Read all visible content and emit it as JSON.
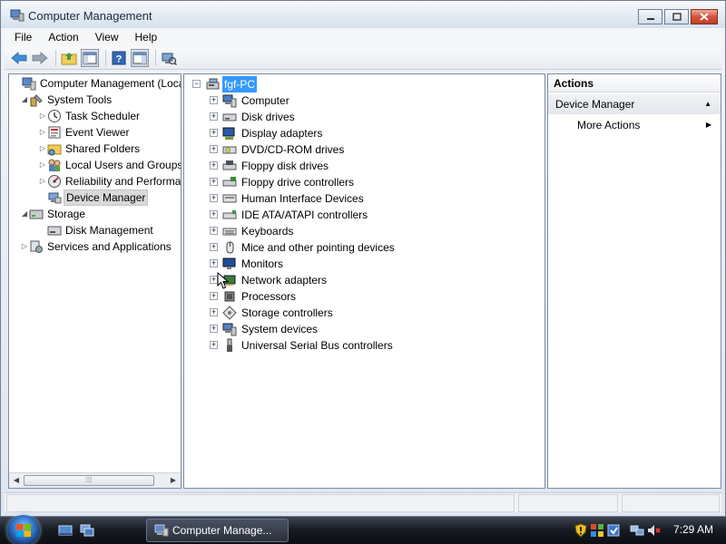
{
  "window": {
    "title": "Computer Management"
  },
  "menu": [
    "File",
    "Action",
    "View",
    "Help"
  ],
  "left_tree": [
    {
      "label": "Computer Management (Local",
      "level": 0,
      "expander": "",
      "icon": "computer-management-icon",
      "selected": false
    },
    {
      "label": "System Tools",
      "level": 1,
      "expander": "expanded",
      "icon": "system-tools-icon",
      "selected": false
    },
    {
      "label": "Task Scheduler",
      "level": 2,
      "expander": "collapsed",
      "icon": "clock-icon",
      "selected": false
    },
    {
      "label": "Event Viewer",
      "level": 2,
      "expander": "collapsed",
      "icon": "event-viewer-icon",
      "selected": false
    },
    {
      "label": "Shared Folders",
      "level": 2,
      "expander": "collapsed",
      "icon": "shared-folder-icon",
      "selected": false
    },
    {
      "label": "Local Users and Groups",
      "level": 2,
      "expander": "collapsed",
      "icon": "users-icon",
      "selected": false
    },
    {
      "label": "Reliability and Performa",
      "level": 2,
      "expander": "collapsed",
      "icon": "performance-icon",
      "selected": false
    },
    {
      "label": "Device Manager",
      "level": 2,
      "expander": "",
      "icon": "device-manager-icon",
      "selected": true
    },
    {
      "label": "Storage",
      "level": 1,
      "expander": "expanded",
      "icon": "storage-icon",
      "selected": false
    },
    {
      "label": "Disk Management",
      "level": 2,
      "expander": "",
      "icon": "disk-management-icon",
      "selected": false
    },
    {
      "label": "Services and Applications",
      "level": 1,
      "expander": "collapsed",
      "icon": "services-icon",
      "selected": false
    }
  ],
  "device_tree": {
    "root": "fgf-PC",
    "items": [
      {
        "label": "Computer",
        "icon": "computer-icon"
      },
      {
        "label": "Disk drives",
        "icon": "disk-drive-icon"
      },
      {
        "label": "Display adapters",
        "icon": "display-adapter-icon"
      },
      {
        "label": "DVD/CD-ROM drives",
        "icon": "dvd-drive-icon"
      },
      {
        "label": "Floppy disk drives",
        "icon": "floppy-drive-icon"
      },
      {
        "label": "Floppy drive controllers",
        "icon": "floppy-controller-icon"
      },
      {
        "label": "Human Interface Devices",
        "icon": "hid-icon"
      },
      {
        "label": "IDE ATA/ATAPI controllers",
        "icon": "ide-controller-icon"
      },
      {
        "label": "Keyboards",
        "icon": "keyboard-icon"
      },
      {
        "label": "Mice and other pointing devices",
        "icon": "mouse-icon"
      },
      {
        "label": "Monitors",
        "icon": "monitor-icon"
      },
      {
        "label": "Network adapters",
        "icon": "network-adapter-icon"
      },
      {
        "label": "Processors",
        "icon": "processor-icon"
      },
      {
        "label": "Storage controllers",
        "icon": "storage-controller-icon"
      },
      {
        "label": "System devices",
        "icon": "system-devices-icon"
      },
      {
        "label": "Universal Serial Bus controllers",
        "icon": "usb-icon"
      }
    ]
  },
  "actions": {
    "header": "Actions",
    "section": "Device Manager",
    "links": [
      "More Actions"
    ]
  },
  "taskbar": {
    "task_label": "Computer Manage...",
    "clock": "7:29 AM"
  },
  "colors": {
    "selection_blue": "#3399ff",
    "tree_selected_gray": "#d8d9db"
  }
}
